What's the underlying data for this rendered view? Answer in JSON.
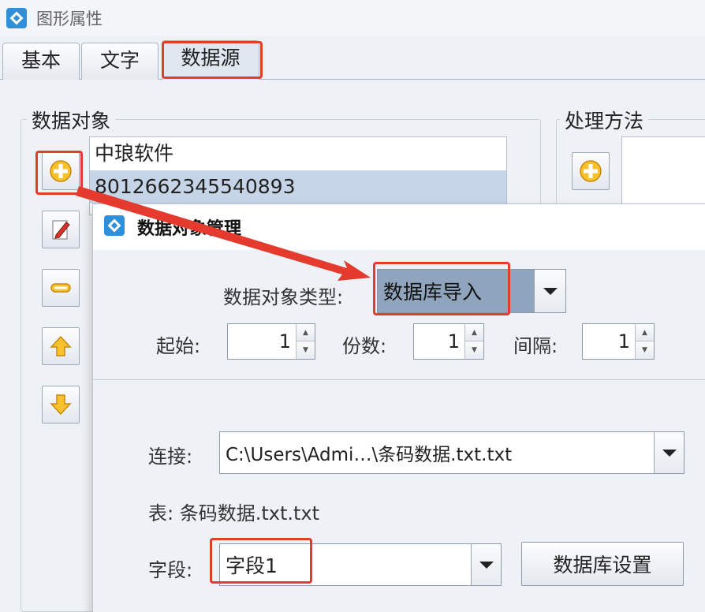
{
  "window": {
    "title": "图形属性"
  },
  "tabs": [
    {
      "label": "基本"
    },
    {
      "label": "文字"
    },
    {
      "label": "数据源"
    }
  ],
  "data_object_group": {
    "legend": "数据对象",
    "items": [
      {
        "label": "中琅软件"
      },
      {
        "label": "8012662345540893"
      }
    ]
  },
  "processing_group": {
    "legend": "处理方法"
  },
  "dialog": {
    "title": "数据对象管理",
    "type_label": "数据对象类型:",
    "type_value": "数据库导入",
    "start_label": "起始:",
    "start_value": "1",
    "copies_label": "份数:",
    "copies_value": "1",
    "interval_label": "间隔:",
    "interval_value": "1",
    "connection_label": "连接:",
    "connection_value": "C:\\Users\\Admi…\\条码数据.txt.txt",
    "table_text": "表: 条码数据.txt.txt",
    "field_label": "字段:",
    "field_value": "字段1",
    "db_settings_label": "数据库设置"
  },
  "colors": {
    "highlight": "#e53a2e",
    "selection": "#c5d4e7"
  }
}
